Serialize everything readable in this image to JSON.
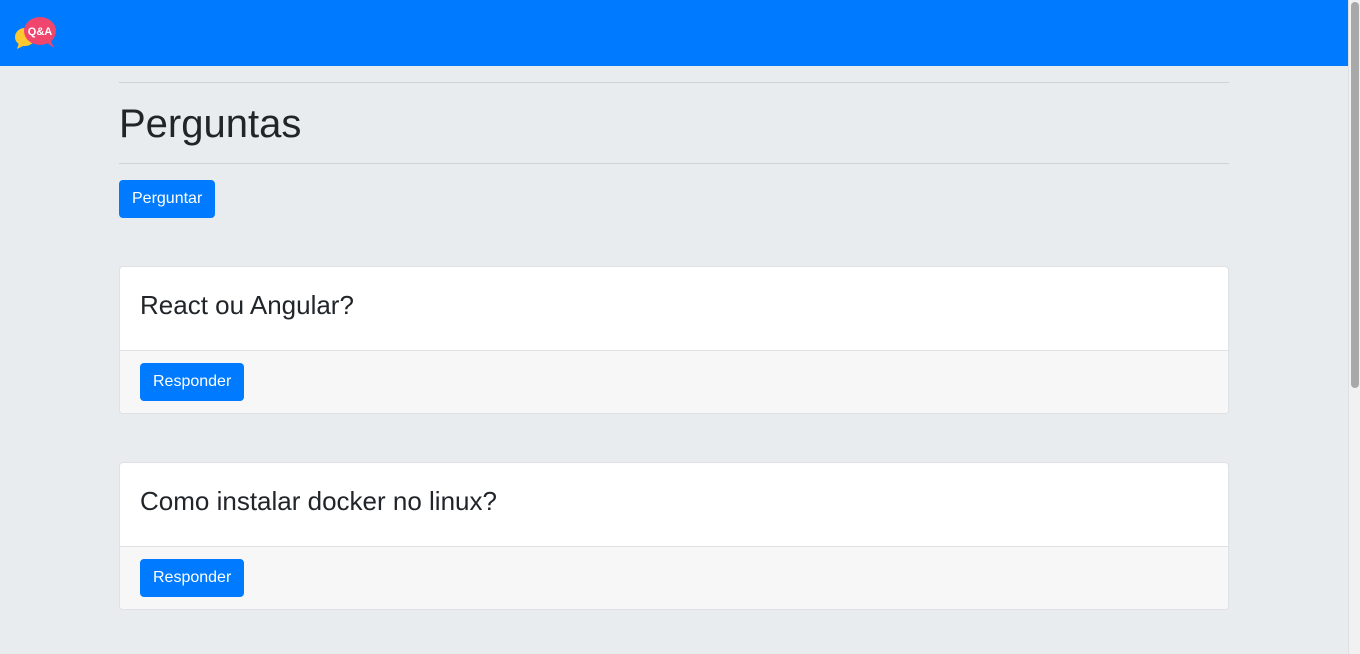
{
  "navbar": {
    "logo_icon": "qa-speech-bubbles-icon",
    "logo_text": "Q&A",
    "bg_color": "#007bff"
  },
  "page": {
    "title": "Perguntas",
    "ask_button_label": "Perguntar"
  },
  "questions": [
    {
      "title": "React ou Angular?",
      "answer_button_label": "Responder"
    },
    {
      "title": "Como instalar docker no linux?",
      "answer_button_label": "Responder"
    }
  ]
}
